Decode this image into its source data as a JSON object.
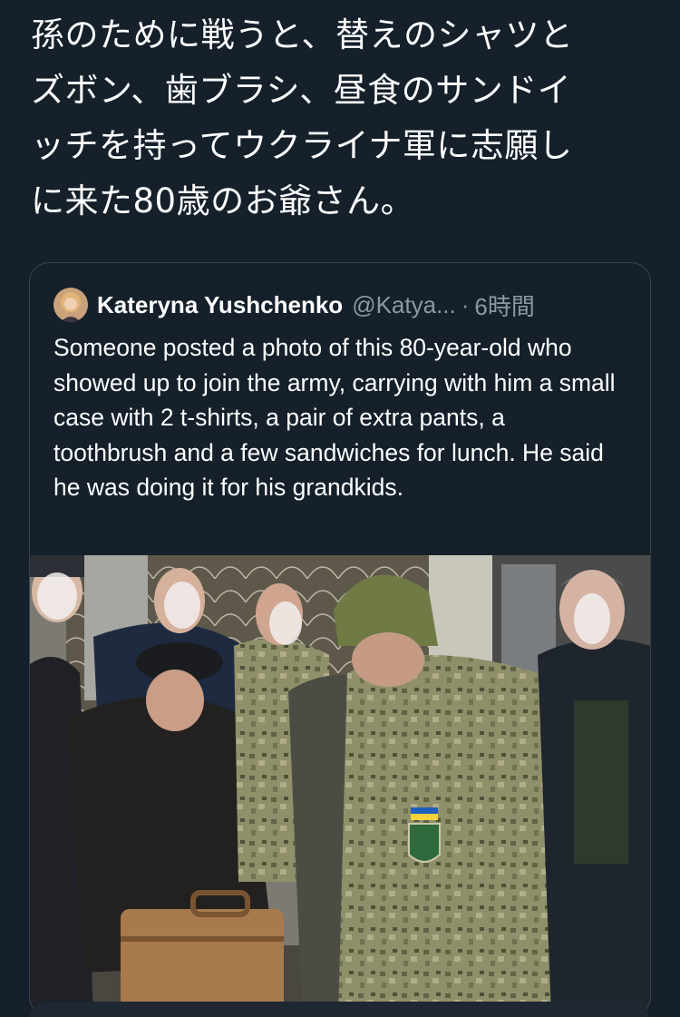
{
  "tweet": {
    "text": "孫のために戦うと、替えのシャツと\nズボン、歯ブラシ、昼食のサンドイ\nッチを持ってウクライナ軍に志願し\nに来た80歳のお爺さん。"
  },
  "quote": {
    "author_name": "Kateryna Yushchenko",
    "author_handle": "@Katya...",
    "separator": "·",
    "timestamp": "6時間",
    "body": "Someone posted a photo of this 80-year-old who showed up to join the army, carrying with him a small case with 2 t-shirts, a pair of extra pants, a toothbrush and a few sandwiches for lunch. He said he was doing it for his grandkids."
  },
  "icons": {
    "avatar": "profile-photo",
    "photo": "men-in-camouflage-uniforms-and-elderly-man-with-suitcase"
  },
  "colors": {
    "background": "#15202b",
    "border": "#38444d",
    "secondary_text": "#8b98a5"
  }
}
